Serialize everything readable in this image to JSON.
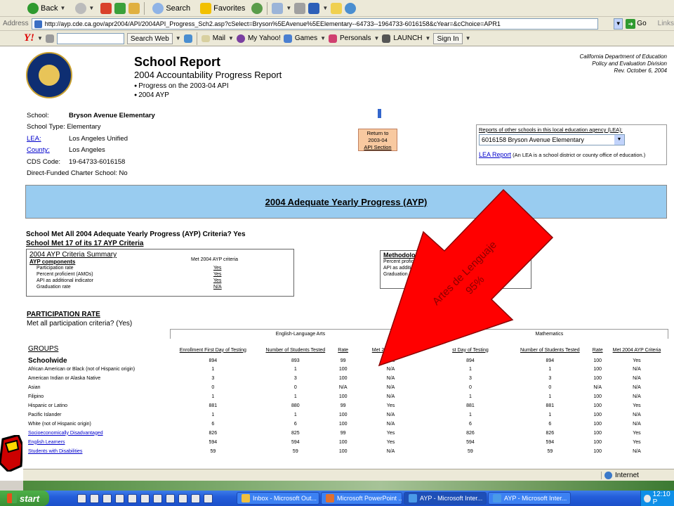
{
  "toolbar": {
    "back": "Back",
    "search": "Search",
    "favorites": "Favorites"
  },
  "address": {
    "label": "Address",
    "url": "http://ayp.cde.ca.gov/apr2004/API/2004API_Progress_Sch2.asp?cSelect=Bryson%5EAvenue%5EElementary--64733--1964733-6016158&cYear=&cChoice=APR1",
    "go": "Go",
    "links": "Links"
  },
  "yahoo": {
    "search_web": "Search Web",
    "mail": "Mail",
    "my_yahoo": "My Yahoo!",
    "games": "Games",
    "personals": "Personals",
    "launch": "LAUNCH",
    "sign_in": "Sign In"
  },
  "report": {
    "title": "School Report",
    "subtitle": "2004 Accountability Progress Report",
    "bullets": [
      "Progress on the 2003-04 API",
      "2004 AYP"
    ],
    "agency_lines": [
      "California Department of Education",
      "Policy and Evaluation Division",
      "Rev. October 6, 2004"
    ]
  },
  "school": {
    "school_label": "School:",
    "school_name": "Bryson Avenue Elementary",
    "type_label": "School Type:",
    "type_value": "Elementary",
    "lea_label": "LEA:",
    "lea_value": "Los Angeles Unified",
    "county_label": "County:",
    "county_value": "Los Angeles",
    "cds_label": "CDS Code:",
    "cds_value": "19-64733-6016158",
    "charter_text": "Direct-Funded Charter School: No"
  },
  "return_button": [
    "Return to",
    "2003-04",
    "API Section"
  ],
  "lea_box": {
    "title": "Reports of other schools in this local education agency (LEA):",
    "selected": "6016158 Bryson Avenue Elementary",
    "report_link": "LEA Report",
    "report_note": "(An LEA is a school district or county office of education.)"
  },
  "ayp": {
    "banner": "2004 Adequate Yearly Progress (AYP)",
    "met_all": "School Met All 2004 Adequate Yearly Progress (AYP) Criteria? Yes",
    "met_count": "School Met  17  of its  17  AYP Criteria"
  },
  "criteria": {
    "title": "2004 AYP Criteria Summary",
    "components": "AYP components",
    "met_label": "Met 2004 AYP criteria",
    "rows": [
      {
        "label": "Participation rate",
        "value": "Yes"
      },
      {
        "label": "Percent proficient (AMOs)",
        "value": "Yes"
      },
      {
        "label": "API as additional indicator",
        "value": "Yes"
      },
      {
        "label": "Graduation rate",
        "value": "N/A"
      }
    ]
  },
  "methodology": {
    "title": "Methodology Used",
    "lines": [
      "Percent proficient (AM",
      "API as additional in",
      "Graduation rate"
    ]
  },
  "participation": {
    "title": "PARTICIPATION RATE",
    "subtitle": "Met all participation criteria? (Yes)",
    "ela_header": "English-Language Arts",
    "math_header": "Mathematics",
    "groups_label": "GROUPS",
    "columns": [
      "Enrollment First Day of Testing",
      "Number of Students Tested",
      "Rate",
      "Met 2004 AYP Cr",
      "st Day of Testing",
      "Number of Students Tested",
      "Rate",
      "Met 2004 AYP Criteria"
    ],
    "rows": [
      {
        "group": "Schoolwide",
        "link": false,
        "cells": [
          "894",
          "893",
          "99",
          "Yes",
          "894",
          "894",
          "100",
          "Yes"
        ]
      },
      {
        "group": "African American or Black (not of Hispanic origin)",
        "link": false,
        "cells": [
          "1",
          "1",
          "100",
          "N/A",
          "1",
          "1",
          "100",
          "N/A"
        ]
      },
      {
        "group": "American Indian or Alaska Native",
        "link": false,
        "cells": [
          "3",
          "3",
          "100",
          "N/A",
          "3",
          "3",
          "100",
          "N/A"
        ]
      },
      {
        "group": "Asian",
        "link": false,
        "cells": [
          "0",
          "0",
          "N/A",
          "N/A",
          "0",
          "0",
          "N/A",
          "N/A"
        ]
      },
      {
        "group": "Filipino",
        "link": false,
        "cells": [
          "1",
          "1",
          "100",
          "N/A",
          "1",
          "1",
          "100",
          "N/A"
        ]
      },
      {
        "group": "Hispanic or Latino",
        "link": false,
        "cells": [
          "881",
          "880",
          "99",
          "Yes",
          "881",
          "881",
          "100",
          "Yes"
        ]
      },
      {
        "group": "Pacific Islander",
        "link": false,
        "cells": [
          "1",
          "1",
          "100",
          "N/A",
          "1",
          "1",
          "100",
          "N/A"
        ]
      },
      {
        "group": "White (not of Hispanic origin)",
        "link": false,
        "cells": [
          "6",
          "6",
          "100",
          "N/A",
          "6",
          "6",
          "100",
          "N/A"
        ]
      },
      {
        "group": "Socioeconomically Disadvantaged",
        "link": true,
        "cells": [
          "826",
          "825",
          "99",
          "Yes",
          "826",
          "826",
          "100",
          "Yes"
        ]
      },
      {
        "group": "English Learners",
        "link": true,
        "cells": [
          "594",
          "594",
          "100",
          "Yes",
          "594",
          "594",
          "100",
          "Yes"
        ]
      },
      {
        "group": "Students with Disabilities",
        "link": true,
        "cells": [
          "59",
          "59",
          "100",
          "N/A",
          "59",
          "59",
          "100",
          "N/A"
        ]
      }
    ]
  },
  "annotation": {
    "line1": "Artes de Lenguaje",
    "line2": "95%",
    "color": "#ff0000"
  },
  "status": {
    "zone": "Internet"
  },
  "taskbar": {
    "start": "start",
    "tasks": [
      "Inbox - Microsoft Out...",
      "Microsoft PowerPoint ...",
      "AYP - Microsoft Inter...",
      "AYP - Microsoft Inter..."
    ],
    "clock": "12:10 P"
  }
}
